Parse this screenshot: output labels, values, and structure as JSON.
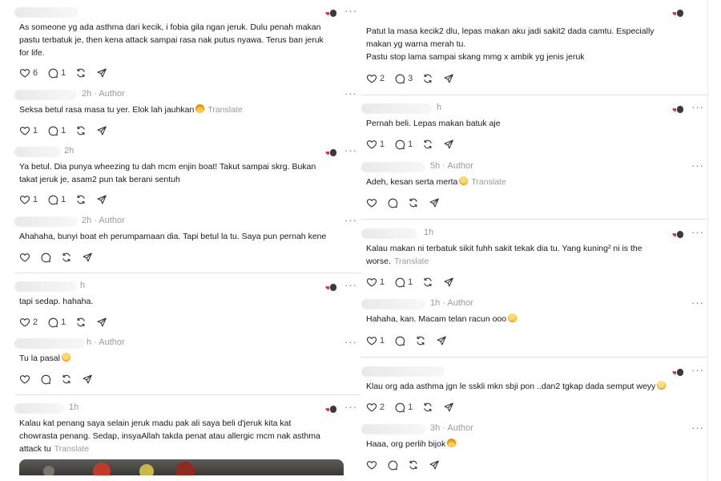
{
  "colors": {
    "heart": "#ef1f38",
    "muted": "#9a9a9a",
    "text": "#1a1a1a",
    "divider": "#e2e2e2"
  },
  "icons": {
    "like": "heart-outline-icon",
    "reply": "chat-bubble-icon",
    "repost": "repost-icon",
    "share": "send-icon",
    "more": "more-dots-icon",
    "liked_by": "liked-by-author-badge"
  },
  "more_glyph": "···",
  "left": {
    "c1": {
      "lines": [
        "As someone yg ada asthma dari kecik, i fobia gila ngan jeruk. Dulu penah makan",
        "pastu terbatuk je, then kena attack sampai rasa nak putus nyawa. Terus ban jeruk",
        "for life."
      ],
      "likes": "6",
      "replies": "1"
    },
    "c2": {
      "time": "2h",
      "author": "Author",
      "text": "Seksa betul rasa masa tu yer. Elok lah jauhkan",
      "translate": "Translate",
      "likes": "1",
      "replies": "1"
    },
    "c3": {
      "time": "2h",
      "lines": [
        "Ya betul. Dia punya wheezing tu dah mcm enjin boat! Takut sampai skrg. Bukan",
        "takat jeruk je, asam2 pun tak berani sentuh"
      ],
      "likes": "1",
      "replies": "1"
    },
    "c4": {
      "time": "2h",
      "author": "Author",
      "text": "Ahahaha, bunyi boat eh perumpamaan dia. Tapi betul la tu. Saya pun pernah kene"
    },
    "c5": {
      "time": "h",
      "text": "tapi sedap. hahaha.",
      "likes": "2",
      "replies": "1"
    },
    "c6": {
      "time": "h",
      "author": "Author",
      "text": "Tu la pasal"
    },
    "c7": {
      "time": "1h",
      "lines": [
        "Kalau kat penang saya selain jeruk madu pak ali saya beli d'jeruk kita kat",
        "chowrasta penang. Sedap, insyaAllah takda penat atau allergic mcm nak asthma"
      ],
      "line3": "attack tu",
      "translate": "Translate"
    }
  },
  "right": {
    "c1": {
      "lines": [
        "Patut la masa kecik2 dlu, lepas makan aku jadi sakit2 dada camtu. Especially",
        "makan yg warna merah tu.",
        "Pastu stop lama sampai skang mmg x ambik yg jenis jeruk"
      ],
      "likes": "2",
      "replies": "3"
    },
    "c2": {
      "time": "h",
      "text": "Pernah beli. Lepas makan batuk aje",
      "likes": "1",
      "replies": "1"
    },
    "c3": {
      "time": "5h",
      "author": "Author",
      "text": "Adeh, kesan serta merta",
      "translate": "Translate"
    },
    "c4": {
      "time": "1h",
      "line1": "Kalau makan ni terbatuk sikit fuhh sakit tekak dia tu. Yang kuning² ni is the",
      "line2": "worse.",
      "translate": "Translate",
      "likes": "1",
      "replies": "1"
    },
    "c5": {
      "time": "1h",
      "author": "Author",
      "text": "Hahaha, kan. Macam telan racun ooo",
      "likes": "1"
    },
    "c6": {
      "text": "Klau org ada asthma jgn le sskli mkn sbji pon ..dan2 tgkap dada semput weyy",
      "likes": "2",
      "replies": "1"
    },
    "c7": {
      "time": "3h",
      "author": "Author",
      "text": "Haaa, org perlih bijok"
    }
  }
}
